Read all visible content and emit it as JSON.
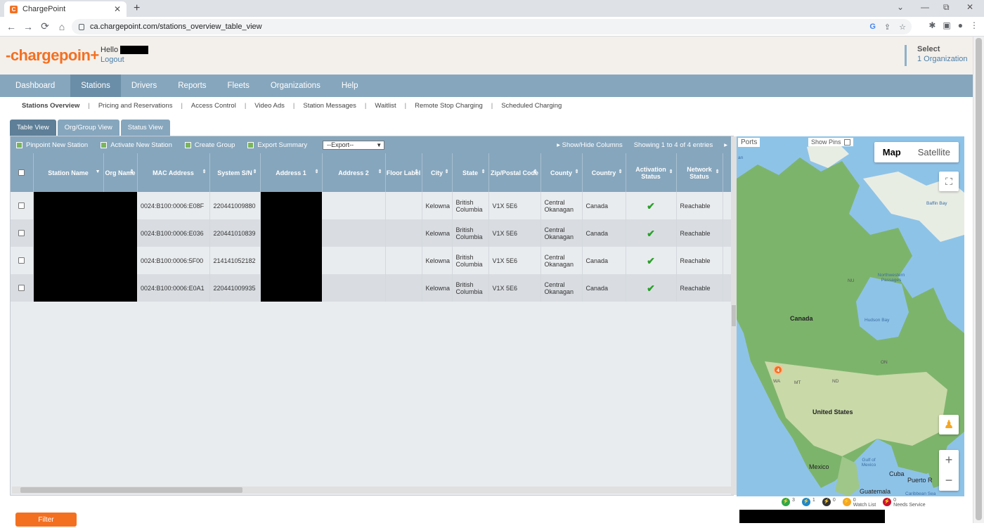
{
  "browser": {
    "tab_title": "ChargePoint",
    "url": "ca.chargepoint.com/stations_overview_table_view",
    "back": "←",
    "forward": "→",
    "reload": "⟳",
    "home": "⌂",
    "new_tab": "+",
    "close_tab": "✕",
    "minimize": "—",
    "restore": "⧉",
    "close_window": "✕",
    "chevron": "⌄"
  },
  "header": {
    "logo": "-chargepoin+",
    "hello": "Hello",
    "logout": "Logout",
    "select_label": "Select",
    "organization": "1 Organization"
  },
  "mainnav": [
    "Dashboard",
    "Stations",
    "Drivers",
    "Reports",
    "Fleets",
    "Organizations",
    "Help"
  ],
  "subnav": [
    "Stations Overview",
    "Pricing and Reservations",
    "Access Control",
    "Video Ads",
    "Station Messages",
    "Waitlist",
    "Remote Stop Charging",
    "Scheduled Charging"
  ],
  "view_tabs": [
    "Table View",
    "Org/Group View",
    "Status View"
  ],
  "toolbar": {
    "pinpoint": "Pinpoint New Station",
    "activate": "Activate New Station",
    "create_group": "Create Group",
    "export_summary": "Export Summary",
    "export_select": "--Export--",
    "show_hide": "Show/Hide Columns",
    "showing": "Showing 1 to 4 of 4 entries"
  },
  "columns": [
    "Station Name",
    "Org Name",
    "MAC Address",
    "System S/N",
    "Address 1",
    "Address 2",
    "Floor Label",
    "City",
    "State",
    "Zip/Postal Code",
    "County",
    "Country",
    "Activation Status",
    "Network Status"
  ],
  "rows": [
    {
      "mac": "0024:B100:0006:E08F",
      "sn": "220441009880",
      "city": "Kelowna",
      "state": "British Columbia",
      "zip": "V1X 5E6",
      "county": "Central Okanagan",
      "country": "Canada",
      "activation": "✔",
      "network": "Reachable"
    },
    {
      "mac": "0024:B100:0006:E036",
      "sn": "220441010839",
      "city": "Kelowna",
      "state": "British Columbia",
      "zip": "V1X 5E6",
      "county": "Central Okanagan",
      "country": "Canada",
      "activation": "✔",
      "network": "Reachable"
    },
    {
      "mac": "0024:B100:0006:5F00",
      "sn": "214141052182",
      "city": "Kelowna",
      "state": "British Columbia",
      "zip": "V1X 5E6",
      "county": "Central Okanagan",
      "country": "Canada",
      "activation": "✔",
      "network": "Reachable"
    },
    {
      "mac": "0024:B100:0006:E0A1",
      "sn": "220441009935",
      "city": "Kelowna",
      "state": "British Columbia",
      "zip": "V1X 5E6",
      "county": "Central Okanagan",
      "country": "Canada",
      "activation": "✔",
      "network": "Reachable"
    }
  ],
  "map": {
    "ports": "Ports",
    "show_pins": "Show Pins",
    "map_btn": "Map",
    "satellite_btn": "Satellite",
    "zoom_in": "+",
    "zoom_out": "−",
    "cluster_count": "4",
    "labels": {
      "canada": "Canada",
      "us": "United States",
      "mexico": "Mexico",
      "cuba": "Cuba",
      "guatemala": "Guatemala",
      "puerto": "Puerto R",
      "hudson": "Hudson Bay",
      "baffin": "Baffin Bay",
      "nw_passages": "Northwestern Passages",
      "gulf": "Gulf of Mexico",
      "caribbean": "Caribbean Sea",
      "an": "an",
      "nu": "NU",
      "on": "ON",
      "mt": "MT",
      "nd": "ND",
      "wa": "WA"
    }
  },
  "legend": [
    {
      "count": "3",
      "color": "#2ea84a"
    },
    {
      "count": "1",
      "color": "#1e88c9"
    },
    {
      "count": "0",
      "color": "#333333"
    },
    {
      "count": "0",
      "label": "Watch List",
      "color": "#f5a623"
    },
    {
      "count": "0",
      "label": "Needs Service",
      "color": "#c8102e"
    }
  ],
  "filter": "Filter"
}
